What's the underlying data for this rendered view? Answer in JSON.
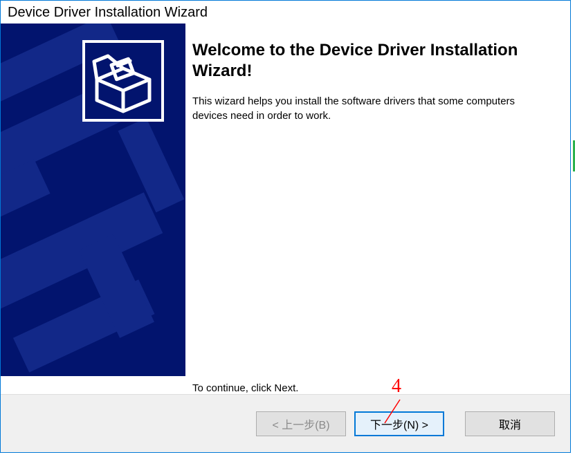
{
  "window": {
    "title": "Device Driver Installation Wizard"
  },
  "content": {
    "heading": "Welcome to the Device Driver Installation Wizard!",
    "description": "This wizard helps you install the software drivers that some computers devices need in order to work.",
    "continue_text": "To continue, click Next."
  },
  "buttons": {
    "back": "< 上一步(B)",
    "next": "下一步(N) >",
    "cancel": "取消"
  },
  "annotation": {
    "number": "4"
  }
}
